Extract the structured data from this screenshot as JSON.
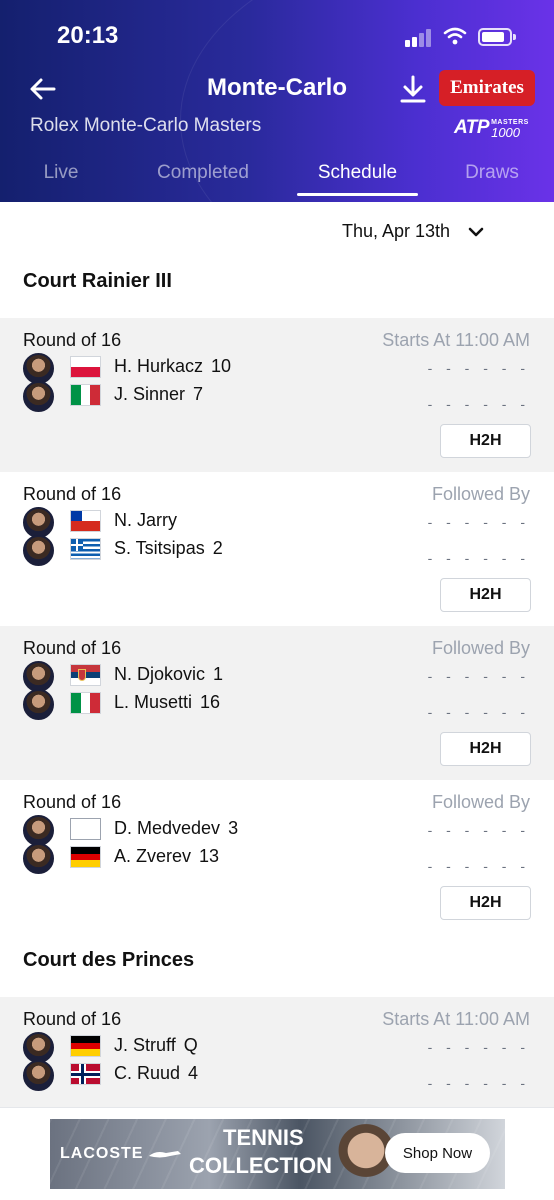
{
  "status_bar": {
    "time": "20:13"
  },
  "header": {
    "title": "Monte-Carlo",
    "subtitle": "Rolex Monte-Carlo Masters",
    "sponsor": "Emirates",
    "logo_atp": "ATP",
    "logo_masters": "MASTERS",
    "logo_tier": "1000",
    "colors": {
      "gradient_start": "#14206e",
      "gradient_end": "#6a32e8",
      "sponsor": "#d61f26"
    }
  },
  "tabs": [
    {
      "label": "Live"
    },
    {
      "label": "Completed"
    },
    {
      "label": "Schedule",
      "active": true
    },
    {
      "label": "Draws"
    }
  ],
  "date_selector": {
    "value": "Thu, Apr 13th"
  },
  "courts": [
    {
      "name": "Court Rainier III",
      "matches": [
        {
          "round": "Round of 16",
          "timing": "Starts At 11:00 AM",
          "players": [
            {
              "name": "H. Hurkacz",
              "seed": "10",
              "flag": "poland",
              "score": "- - - - - -"
            },
            {
              "name": "J. Sinner",
              "seed": "7",
              "flag": "italy",
              "score": "- - - - - -"
            }
          ],
          "h2h": "H2H"
        },
        {
          "round": "Round of 16",
          "timing": "Followed By",
          "players": [
            {
              "name": "N. Jarry",
              "seed": "",
              "flag": "chile",
              "score": "- - - - - -"
            },
            {
              "name": "S. Tsitsipas",
              "seed": "2",
              "flag": "greece",
              "score": "- - - - - -"
            }
          ],
          "h2h": "H2H"
        },
        {
          "round": "Round of 16",
          "timing": "Followed By",
          "players": [
            {
              "name": "N. Djokovic",
              "seed": "1",
              "flag": "serbia",
              "score": "- - - - - -"
            },
            {
              "name": "L. Musetti",
              "seed": "16",
              "flag": "italy",
              "score": "- - - - - -"
            }
          ],
          "h2h": "H2H"
        },
        {
          "round": "Round of 16",
          "timing": "Followed By",
          "players": [
            {
              "name": "D. Medvedev",
              "seed": "3",
              "flag": "blank",
              "score": "- - - - - -"
            },
            {
              "name": "A. Zverev",
              "seed": "13",
              "flag": "germany",
              "score": "- - - - - -"
            }
          ],
          "h2h": "H2H"
        }
      ]
    },
    {
      "name": "Court des Princes",
      "matches": [
        {
          "round": "Round of 16",
          "timing": "Starts At 11:00 AM",
          "players": [
            {
              "name": "J. Struff",
              "seed": "Q",
              "flag": "germany",
              "score": "- - - - - -"
            },
            {
              "name": "C. Ruud",
              "seed": "4",
              "flag": "norway",
              "score": "- - - - - -"
            }
          ]
        }
      ]
    }
  ],
  "ad": {
    "brand": "LACOSTE",
    "line1": "TENNIS",
    "line2": "COLLECTION",
    "cta": "Shop Now"
  }
}
